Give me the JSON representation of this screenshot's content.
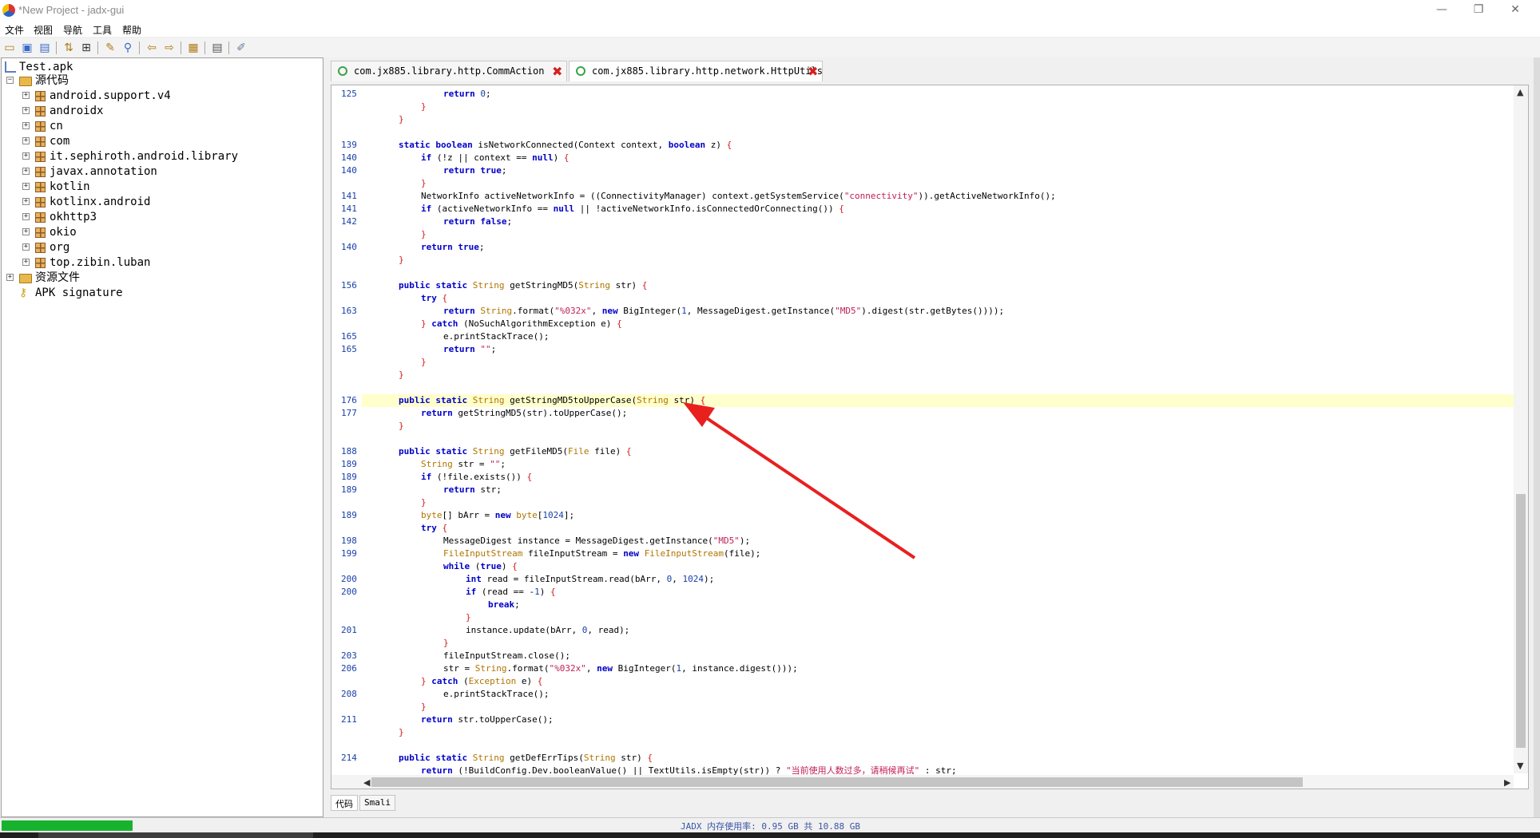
{
  "window": {
    "title": "*New Project - jadx-gui"
  },
  "menu": [
    "文件",
    "视图",
    "导航",
    "工具",
    "帮助"
  ],
  "tree": {
    "root": "Test.apk",
    "sources": "源代码",
    "packages": [
      "android.support.v4",
      "androidx",
      "cn",
      "com",
      "it.sephiroth.android.library",
      "javax.annotation",
      "kotlin",
      "kotlinx.android",
      "okhttp3",
      "okio",
      "org",
      "top.zibin.luban"
    ],
    "resources": "资源文件",
    "signature": "APK signature"
  },
  "tabs": [
    {
      "label": "com.jx885.library.http.CommAction",
      "active": false
    },
    {
      "label": "com.jx885.library.http.network.HttpUtils",
      "active": true
    }
  ],
  "code_lines": [
    {
      "n": "125",
      "indent": 3,
      "html": "<span class=\"kw\">return</span> <span class=\"num\">0</span>;"
    },
    {
      "n": "",
      "indent": 2,
      "html": "<span class=\"br\">}</span>"
    },
    {
      "n": "",
      "indent": 1,
      "html": "<span class=\"br\">}</span>"
    },
    {
      "n": "",
      "indent": 0,
      "html": ""
    },
    {
      "n": "139",
      "indent": 1,
      "html": "<span class=\"kw\">static</span> <span class=\"kw\">boolean</span> isNetworkConnected(Context context, <span class=\"kw\">boolean</span> z) <span class=\"br\">{</span>"
    },
    {
      "n": "140",
      "indent": 2,
      "html": "<span class=\"kw\">if</span> (!z || context == <span class=\"kw\">null</span>) <span class=\"br\">{</span>"
    },
    {
      "n": "140",
      "indent": 3,
      "html": "<span class=\"kw\">return</span> <span class=\"kw\">true</span>;"
    },
    {
      "n": "",
      "indent": 2,
      "html": "<span class=\"br\">}</span>"
    },
    {
      "n": "141",
      "indent": 2,
      "html": "NetworkInfo activeNetworkInfo = ((ConnectivityManager) context.getSystemService(<span class=\"str\">\"connectivity\"</span>)).getActiveNetworkInfo();"
    },
    {
      "n": "141",
      "indent": 2,
      "html": "<span class=\"kw\">if</span> (activeNetworkInfo == <span class=\"kw\">null</span> || !activeNetworkInfo.isConnectedOrConnecting()) <span class=\"br\">{</span>"
    },
    {
      "n": "142",
      "indent": 3,
      "html": "<span class=\"kw\">return</span> <span class=\"kw\">false</span>;"
    },
    {
      "n": "",
      "indent": 2,
      "html": "<span class=\"br\">}</span>"
    },
    {
      "n": "140",
      "indent": 2,
      "html": "<span class=\"kw\">return</span> <span class=\"kw\">true</span>;"
    },
    {
      "n": "",
      "indent": 1,
      "html": "<span class=\"br\">}</span>"
    },
    {
      "n": "",
      "indent": 0,
      "html": ""
    },
    {
      "n": "156",
      "indent": 1,
      "html": "<span class=\"kw\">public</span> <span class=\"kw\">static</span> <span class=\"ty\">String</span> getStringMD5(<span class=\"ty\">String</span> str) <span class=\"br\">{</span>"
    },
    {
      "n": "",
      "indent": 2,
      "html": "<span class=\"kw\">try</span> <span class=\"br\">{</span>"
    },
    {
      "n": "163",
      "indent": 3,
      "html": "<span class=\"kw\">return</span> <span class=\"ty\">String</span>.format(<span class=\"str\">\"%032x\"</span>, <span class=\"kw\">new</span> BigInteger(<span class=\"num\">1</span>, MessageDigest.getInstance(<span class=\"str\">\"MD5\"</span>).digest(str.getBytes())));"
    },
    {
      "n": "",
      "indent": 2,
      "html": "<span class=\"br\">}</span> <span class=\"kw\">catch</span> (NoSuchAlgorithmException e) <span class=\"br\">{</span>"
    },
    {
      "n": "165",
      "indent": 3,
      "html": "e.printStackTrace();"
    },
    {
      "n": "165",
      "indent": 3,
      "html": "<span class=\"kw\">return</span> <span class=\"str\">\"\"</span>;"
    },
    {
      "n": "",
      "indent": 2,
      "html": "<span class=\"br\">}</span>"
    },
    {
      "n": "",
      "indent": 1,
      "html": "<span class=\"br\">}</span>"
    },
    {
      "n": "",
      "indent": 0,
      "html": ""
    },
    {
      "n": "176",
      "indent": 1,
      "hl": true,
      "html": "<span class=\"kw\">public</span> <span class=\"kw\">static</span> <span class=\"ty\">String</span> getStringMD5toUpperCase(<span class=\"ty\">String</span> str) <span class=\"br\">{</span>"
    },
    {
      "n": "177",
      "indent": 2,
      "html": "<span class=\"kw\">return</span> getStringMD5(str).toUpperCase();"
    },
    {
      "n": "",
      "indent": 1,
      "html": "<span class=\"br\">}</span>"
    },
    {
      "n": "",
      "indent": 0,
      "html": ""
    },
    {
      "n": "188",
      "indent": 1,
      "html": "<span class=\"kw\">public</span> <span class=\"kw\">static</span> <span class=\"ty\">String</span> getFileMD5(<span class=\"ty\">File</span> file) <span class=\"br\">{</span>"
    },
    {
      "n": "189",
      "indent": 2,
      "html": "<span class=\"ty\">String</span> str = <span class=\"str\">\"\"</span>;"
    },
    {
      "n": "189",
      "indent": 2,
      "html": "<span class=\"kw\">if</span> (!file.exists()) <span class=\"br\">{</span>"
    },
    {
      "n": "189",
      "indent": 3,
      "html": "<span class=\"kw\">return</span> str;"
    },
    {
      "n": "",
      "indent": 2,
      "html": "<span class=\"br\">}</span>"
    },
    {
      "n": "189",
      "indent": 2,
      "html": "<span class=\"ty\">byte</span>[] bArr = <span class=\"kw\">new</span> <span class=\"ty\">byte</span>[<span class=\"num\">1024</span>];"
    },
    {
      "n": "",
      "indent": 2,
      "html": "<span class=\"kw\">try</span> <span class=\"br\">{</span>"
    },
    {
      "n": "198",
      "indent": 3,
      "html": "MessageDigest instance = MessageDigest.getInstance(<span class=\"str\">\"MD5\"</span>);"
    },
    {
      "n": "199",
      "indent": 3,
      "html": "<span class=\"ty\">FileInputStream</span> fileInputStream = <span class=\"kw\">new</span> <span class=\"ty\">FileInputStream</span>(file);"
    },
    {
      "n": "",
      "indent": 3,
      "html": "<span class=\"kw\">while</span> (<span class=\"kw\">true</span>) <span class=\"br\">{</span>"
    },
    {
      "n": "200",
      "indent": 4,
      "html": "<span class=\"kw\">int</span> read = fileInputStream.read(bArr, <span class=\"num\">0</span>, <span class=\"num\">1024</span>);"
    },
    {
      "n": "200",
      "indent": 4,
      "html": "<span class=\"kw\">if</span> (read == -<span class=\"num\">1</span>) <span class=\"br\">{</span>"
    },
    {
      "n": "",
      "indent": 5,
      "html": "<span class=\"kw\">break</span>;"
    },
    {
      "n": "",
      "indent": 4,
      "html": "<span class=\"br\">}</span>"
    },
    {
      "n": "201",
      "indent": 4,
      "html": "instance.update(bArr, <span class=\"num\">0</span>, read);"
    },
    {
      "n": "",
      "indent": 3,
      "html": "<span class=\"br\">}</span>"
    },
    {
      "n": "203",
      "indent": 3,
      "html": "fileInputStream.close();"
    },
    {
      "n": "206",
      "indent": 3,
      "html": "str = <span class=\"ty\">String</span>.format(<span class=\"str\">\"%032x\"</span>, <span class=\"kw\">new</span> BigInteger(<span class=\"num\">1</span>, instance.digest()));"
    },
    {
      "n": "",
      "indent": 2,
      "html": "<span class=\"br\">}</span> <span class=\"kw\">catch</span> (<span class=\"ty\">Exception</span> e) <span class=\"br\">{</span>"
    },
    {
      "n": "208",
      "indent": 3,
      "html": "e.printStackTrace();"
    },
    {
      "n": "",
      "indent": 2,
      "html": "<span class=\"br\">}</span>"
    },
    {
      "n": "211",
      "indent": 2,
      "html": "<span class=\"kw\">return</span> str.toUpperCase();"
    },
    {
      "n": "",
      "indent": 1,
      "html": "<span class=\"br\">}</span>"
    },
    {
      "n": "",
      "indent": 0,
      "html": ""
    },
    {
      "n": "214",
      "indent": 1,
      "html": "<span class=\"kw\">public</span> <span class=\"kw\">static</span> <span class=\"ty\">String</span> getDefErrTips(<span class=\"ty\">String</span> str) <span class=\"br\">{</span>"
    },
    {
      "n": "",
      "indent": 2,
      "html": "<span class=\"kw\">return</span> (!BuildConfig.Dev.booleanValue() || TextUtils.isEmpty(str)) ? <span class=\"str\">\"当前使用人数过多，请稍候再试\"</span> : str;"
    }
  ],
  "bottom_tabs": [
    "代码",
    "Smali"
  ],
  "status": {
    "memory": "JADX 内存使用率: 0.95 GB 共 10.88 GB"
  },
  "colors": {
    "accent_arrow": "#e8201e",
    "highlight_line": "#ffffcc",
    "progress": "#17b32e"
  }
}
